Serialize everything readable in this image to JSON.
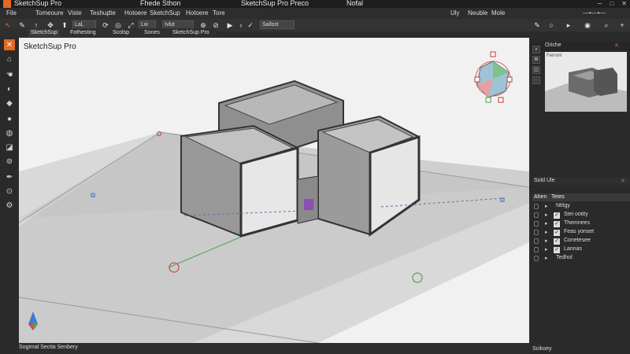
{
  "titlebar": {
    "app": "SketchSup Pro",
    "mid": "Fhede Sthon",
    "doc": "SketchSup Pro Preco",
    "right": "Nofal"
  },
  "menu": {
    "items": [
      "File",
      "Tomeoure",
      "Viste",
      "Teshup",
      "Ite",
      "Hotoere",
      "SketchSup",
      "Hotoere",
      "Tore"
    ],
    "right": [
      "Uly",
      "Neuble",
      "Mole"
    ]
  },
  "toolbar": {
    "field1": "LaL",
    "field2": "Ivlut",
    "field3": "Lw",
    "field4": "Sallsst",
    "extras": [
      "SketchSup",
      "Fothesting",
      "Scolsp",
      "Sones",
      "SketchSup Pro"
    ]
  },
  "viewport": {
    "title": "SketchSup Pro"
  },
  "rightpanel": {
    "header": "Oriche",
    "preview_label": "Ferronl",
    "section": "Sold Ule",
    "tabs": [
      "Ahen",
      "Tetes"
    ],
    "layers": [
      {
        "name": "Ntitgy",
        "checked": false
      },
      {
        "name": "Stei ootity",
        "checked": true
      },
      {
        "name": "Themnees",
        "checked": true
      },
      {
        "name": "Feas yonset",
        "checked": true
      },
      {
        "name": "Conetesee",
        "checked": true
      },
      {
        "name": "Lannas",
        "checked": true
      },
      {
        "name": "Tedhol",
        "checked": false
      }
    ]
  },
  "status": {
    "left": "Sogimal   Sectia Senbery",
    "right": "Scikoey"
  },
  "colors": {
    "accent_orange": "#e06a25",
    "viewport_bg": "#f1f1f1",
    "chrome_dark": "#2b2b2b"
  }
}
